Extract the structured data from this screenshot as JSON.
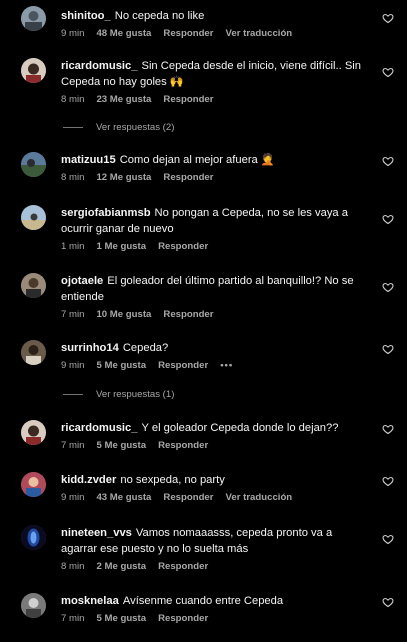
{
  "comments": [
    {
      "user": "shinitoo_",
      "text": "No cepeda no like",
      "time": "9 min",
      "likes": "48 Me gusta",
      "reply": "Responder",
      "translate": "Ver traducción",
      "avatar_color": "#8a9aa8"
    },
    {
      "user": "ricardomusic_",
      "text": "Sin Cepeda desde el inicio, viene difícil.. Sin Cepeda no hay goles 🙌",
      "time": "8 min",
      "likes": "23 Me gusta",
      "reply": "Responder",
      "avatar_color": "#c9b9a8"
    },
    {
      "user": "matizuu15",
      "text": "Como dejan al mejor afuera 🤦",
      "time": "8 min",
      "likes": "12 Me gusta",
      "reply": "Responder",
      "avatar_color": "#5a7a9a"
    },
    {
      "user": "sergiofabianmsb",
      "text": "No pongan a Cepeda, no se les vaya a ocurrir ganar de nuevo",
      "time": "1 min",
      "likes": "1 Me gusta",
      "reply": "Responder",
      "avatar_color": "#a8c0d8"
    },
    {
      "user": "ojotaele",
      "text": "El goleador del último partido al banquillo!? No se entiende",
      "time": "7 min",
      "likes": "10 Me gusta",
      "reply": "Responder",
      "avatar_color": "#9a8a7a"
    },
    {
      "user": "surrinho14",
      "text": "Cepeda?",
      "time": "9 min",
      "likes": "5 Me gusta",
      "reply": "Responder",
      "more": "•••",
      "avatar_color": "#6a5a4a"
    },
    {
      "user": "ricardomusic_",
      "text": "Y el goleador Cepeda donde lo dejan??",
      "time": "7 min",
      "likes": "5 Me gusta",
      "reply": "Responder",
      "avatar_color": "#c9b9a8"
    },
    {
      "user": "kidd.zvder",
      "text": "no sexpeda, no party",
      "time": "9 min",
      "likes": "43 Me gusta",
      "reply": "Responder",
      "translate": "Ver traducción",
      "avatar_color": "#b04a5a"
    },
    {
      "user": "nineteen_vvs",
      "text": "Vamos nomaaasss, cepeda pronto va a agarrar ese puesto y no lo suelta más",
      "time": "8 min",
      "likes": "2 Me gusta",
      "reply": "Responder",
      "avatar_color": "#1e4aa0"
    },
    {
      "user": "mosknelaa",
      "text": "Avísenme cuando entre Cepeda",
      "time": "7 min",
      "likes": "5 Me gusta",
      "reply": "Responder",
      "avatar_color": "#7a7a7a"
    }
  ],
  "replies": [
    {
      "label": "Ver respuestas (2)"
    },
    {
      "label": "Ver respuestas (1)"
    }
  ]
}
